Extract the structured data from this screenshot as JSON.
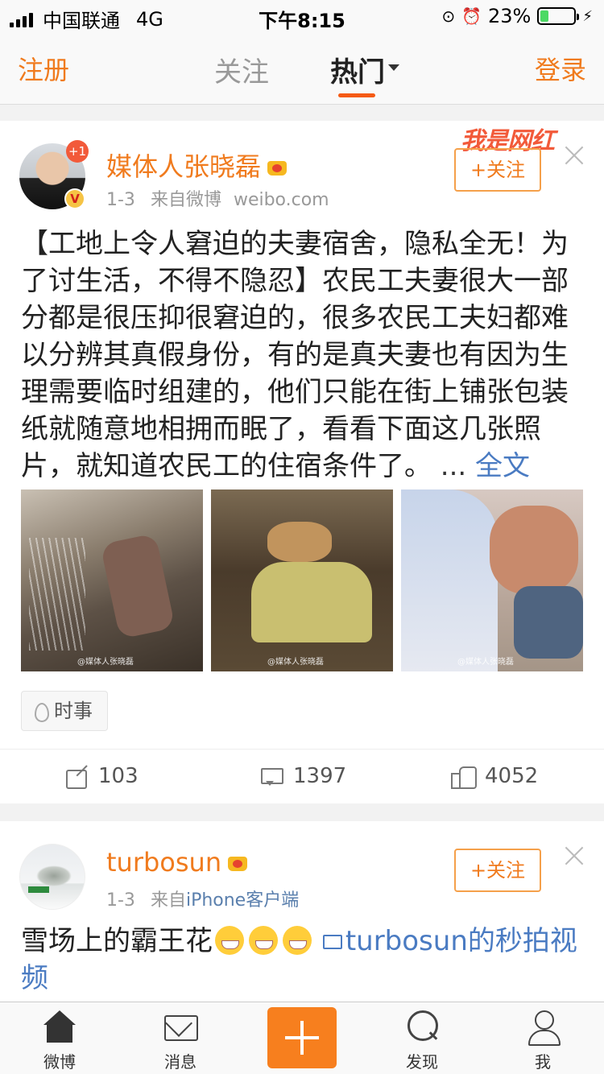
{
  "status_bar": {
    "carrier": "中国联通",
    "network": "4G",
    "time": "下午8:15",
    "battery_percent": "23%",
    "battery_level": 0.23
  },
  "nav": {
    "register": "注册",
    "tab_follow": "关注",
    "tab_hot": "热门",
    "login": "登录"
  },
  "posts": [
    {
      "badge": "+1",
      "verified_badge": "V",
      "username": "媒体人张晓磊",
      "time": "1-3",
      "source_prefix": "来自微博",
      "source": "weibo.com",
      "watermark": "我是网红",
      "follow": "+关注",
      "text": "【工地上令人窘迫的夫妻宿舍，隐私全无！为了讨生活，不得不隐忍】农民工夫妻很大一部分都是很压抑很窘迫的，很多农民工夫妇都难以分辨其真假身份，有的是真夫妻也有因为生理需要临时组建的，他们只能在街上铺张包装纸就随意地相拥而眠了，看看下面这几张照片，就知道农民工的住宿条件了。",
      "ellipsis": " ...",
      "more": "全文",
      "photo_watermarks": [
        "@媒体人张晓磊",
        "@媒体人张晓磊",
        "@媒体人张晓磊"
      ],
      "topic": "时事",
      "reposts": "103",
      "comments": "1397",
      "likes": "4052"
    },
    {
      "username": "turbosun",
      "time": "1-3",
      "source_prefix": "来自",
      "source": "iPhone客户端",
      "follow": "+关注",
      "text": "雪场上的霸王花",
      "video_link": "turbosun的秒拍视频"
    }
  ],
  "tabbar": {
    "home": "微博",
    "messages": "消息",
    "discover": "发现",
    "me": "我"
  },
  "colors": {
    "accent": "#f07b1e",
    "link": "#4a7bc2",
    "tab_underline": "#f55a14"
  }
}
